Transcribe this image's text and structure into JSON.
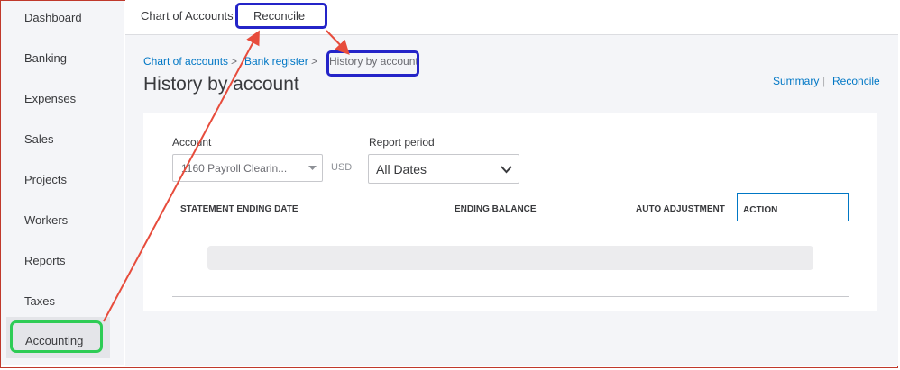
{
  "sidebar": {
    "items": [
      {
        "label": "Dashboard"
      },
      {
        "label": "Banking"
      },
      {
        "label": "Expenses"
      },
      {
        "label": "Sales"
      },
      {
        "label": "Projects"
      },
      {
        "label": "Workers"
      },
      {
        "label": "Reports"
      },
      {
        "label": "Taxes"
      },
      {
        "label": "Accounting"
      }
    ],
    "active": "Accounting"
  },
  "topnav": {
    "tabs": [
      {
        "label": "Chart of Accounts"
      },
      {
        "label": "Reconcile"
      }
    ],
    "highlighted": "Reconcile"
  },
  "breadcrumb": {
    "items": [
      {
        "label": "Chart of accounts"
      },
      {
        "label": "Bank register"
      }
    ],
    "separator": ">",
    "current": "History by account"
  },
  "page": {
    "title": "History by account",
    "links": {
      "summary": "Summary",
      "separator": "|",
      "reconcile": "Reconcile"
    }
  },
  "filters": {
    "account_label": "Account",
    "account_value": "1160 Payroll Clearin...",
    "currency": "USD",
    "period_label": "Report period",
    "period_value": "All Dates"
  },
  "table": {
    "columns": [
      "STATEMENT ENDING DATE",
      "ENDING BALANCE",
      "AUTO ADJUSTMENT",
      "ACTION"
    ],
    "rows": []
  },
  "colors": {
    "link": "#0077c5",
    "annotation_arrow": "#e74c3c",
    "annotation_box_blue": "#2424c8",
    "annotation_box_green": "#2ecc55",
    "frame": "#c0392b"
  },
  "icons": {
    "account_dropdown": "caret-down-icon",
    "period_dropdown": "chevron-down-icon"
  }
}
